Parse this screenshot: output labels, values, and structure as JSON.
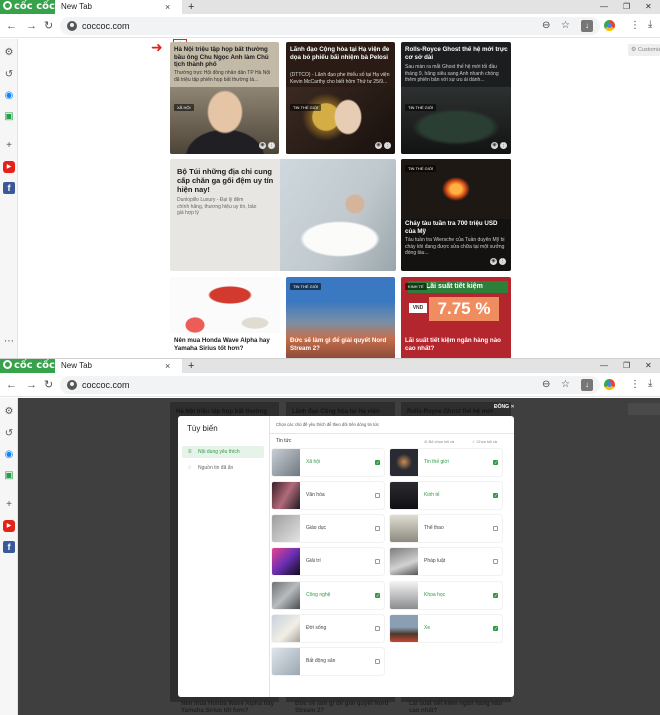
{
  "browser": {
    "brand": "cốc cốc",
    "tab_title": "New Tab",
    "tab_close": "×",
    "new_tab": "+",
    "url": "coccoc.com",
    "win_min": "—",
    "win_max": "❐",
    "win_close": "✕"
  },
  "page": {
    "customize_label": "Customize",
    "cards": [
      {
        "title": "Hà Nội triệu tập họp bất thường bầu ông Chu Ngọc Anh làm Chủ tịch thành phố",
        "desc": "Thường trực Hội đồng nhân dân TP Hà Nội đã triệu tập phiên họp bất thường tá...",
        "tag": "XÃ HỘI"
      },
      {
        "title": "Lãnh đạo Cộng hòa tại Hạ viện đe dọa bỏ phiếu bãi nhiệm bà Pelosi",
        "desc": "(DTTCO) - Lãnh đạo phe thiểu số tại Hạ viện Kevin McCarthy cho biết hôm Thứ tư 25/9...",
        "tag": "TIN THẾ GIỚI"
      },
      {
        "title": "Rolls-Royce Ghost thế hệ mới trực cơ sở dài",
        "desc": "Sau màn ra mắt Ghost thế hệ mới tối đầu tháng 9, hãng siêu sang Anh nhanh chóng thêm phiên bản với sự ưu ái dành...",
        "tag": "TIN THẾ GIỚI"
      },
      {
        "title": "Bộ Túi những địa chỉ cung cấp chăn ga gối đệm uy tín hiện nay!",
        "desc": "Dunlopillo Luxury - Đại lý đệm chính hãng, thương hiệu uy tín, bảo giá hợp lý"
      },
      {
        "title": "Cháy tàu tuần tra 700 triệu USD của Mỹ",
        "desc": "Tàu tuần tra Wiersche của Tuần duyên Mỹ bị cháy khi đang được sửa chữa tại một xưởng đóng tàu...",
        "tag": "TIN THẾ GIỚI"
      },
      {
        "title": "Nên mua Honda Wave Alpha hay Yamaha Sirius tốt hơn?"
      },
      {
        "title": "Đức sẽ làm gì để giải quyết Nord Stream 2?",
        "tag": "TIN THẾ GIỚI"
      },
      {
        "title": "Lãi suất tiết kiệm ngân hàng nào cao nhất?",
        "tag": "KINH TẾ",
        "banner": "Lãi suất tiết kiệm",
        "currency": "VND",
        "rate": "7.75 %"
      }
    ],
    "dimmed_titles": [
      "Hà Nội triệu tập họp bất thường",
      "Lãnh đạo Cộng hòa tại Hạ viện",
      "Rolls-Royce Ghost thế hệ mới"
    ],
    "dimmed_bottom": [
      "Nên mua Honda Wave Alpha hay Yamaha Sirius tốt hơn?",
      "Đức sẽ làm gì để giải quyết Nord Stream 2?",
      "Lãi suất tiết kiệm ngân hàng nào cao nhất?"
    ]
  },
  "modal": {
    "title": "Tùy biến",
    "close_label": "ĐÓNG ✕",
    "nav": [
      "Nội dung yêu thích",
      "Nguồn tin đã ẩn"
    ],
    "subtitle": "Chọn các chủ đề yêu thích để theo dõi trên dòng tin tức",
    "section": "Tin tức",
    "deselect_all": "Bỏ chọn tất cả",
    "select_all": "Chọn tất cả",
    "topics": [
      {
        "label": "Xã hội",
        "checked": true
      },
      {
        "label": "Tin thế giới",
        "checked": true
      },
      {
        "label": "Văn hóa",
        "checked": false
      },
      {
        "label": "Kinh tế",
        "checked": true
      },
      {
        "label": "Giáo dục",
        "checked": false
      },
      {
        "label": "Thể thao",
        "checked": false
      },
      {
        "label": "Giải trí",
        "checked": false
      },
      {
        "label": "Pháp luật",
        "checked": false
      },
      {
        "label": "Công nghệ",
        "checked": true
      },
      {
        "label": "Khoa học",
        "checked": true
      },
      {
        "label": "Đời sống",
        "checked": false
      },
      {
        "label": "Xe",
        "checked": true
      },
      {
        "label": "Bất động sản",
        "checked": false
      }
    ]
  },
  "colors": {
    "brand_green": "#36a24a",
    "accent_green": "#2f9b45",
    "highlight_red": "#e2231a"
  }
}
